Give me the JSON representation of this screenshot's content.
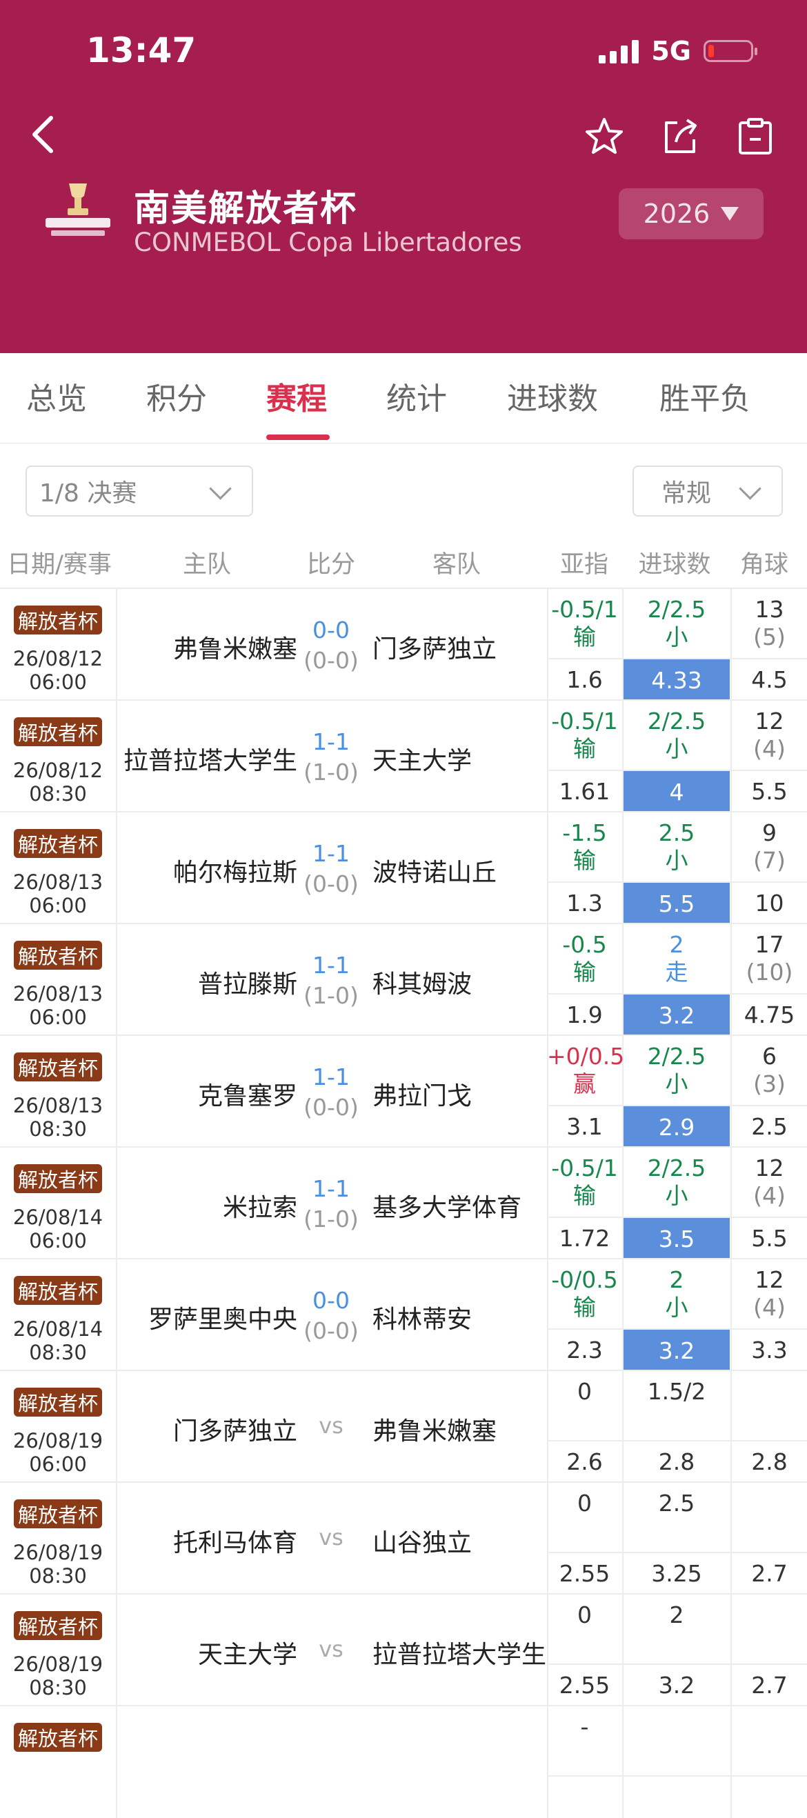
{
  "status": {
    "time": "13:47",
    "network": "5G"
  },
  "header": {
    "title_cn": "南美解放者杯",
    "title_en": "CONMEBOL Copa Libertadores",
    "year": "2026"
  },
  "tabs": [
    "总览",
    "积分",
    "赛程",
    "统计",
    "进球数",
    "胜平负"
  ],
  "filters": {
    "round": "1/8 决赛",
    "mode": "常规"
  },
  "columns": [
    "日期/赛事",
    "主队",
    "比分",
    "客队",
    "亚指",
    "进球数",
    "角球"
  ],
  "matches": [
    {
      "comp": "解放者杯",
      "date": "26/08/12",
      "time": "06:00",
      "home": "弗鲁米嫩塞",
      "away": "门多萨独立",
      "ft": "0-0",
      "ht": "(0-0)",
      "ah": "-0.5/1",
      "ah_res": "输",
      "ah_odds": "1.6",
      "goals": "2/2.5",
      "goals_res": "小",
      "goals_odds": "4.33",
      "corner": "13",
      "corner_ht": "(5)",
      "corner_odds": "4.5"
    },
    {
      "comp": "解放者杯",
      "date": "26/08/12",
      "time": "08:30",
      "home": "拉普拉塔大学生",
      "away": "天主大学",
      "ft": "1-1",
      "ht": "(1-0)",
      "ah": "-0.5/1",
      "ah_res": "输",
      "ah_odds": "1.61",
      "goals": "2/2.5",
      "goals_res": "小",
      "goals_odds": "4",
      "corner": "12",
      "corner_ht": "(4)",
      "corner_odds": "5.5"
    },
    {
      "comp": "解放者杯",
      "date": "26/08/13",
      "time": "06:00",
      "home": "帕尔梅拉斯",
      "away": "波特诺山丘",
      "ft": "1-1",
      "ht": "(0-0)",
      "ah": "-1.5",
      "ah_res": "输",
      "ah_odds": "1.3",
      "goals": "2.5",
      "goals_res": "小",
      "goals_odds": "5.5",
      "corner": "9",
      "corner_ht": "(7)",
      "corner_odds": "10"
    },
    {
      "comp": "解放者杯",
      "date": "26/08/13",
      "time": "06:00",
      "home": "普拉滕斯",
      "away": "科其姆波",
      "ft": "1-1",
      "ht": "(1-0)",
      "ah": "-0.5",
      "ah_res": "输",
      "ah_odds": "1.9",
      "goals": "2",
      "goals_res": "走",
      "goals_odds": "3.2",
      "corner": "17",
      "corner_ht": "(10)",
      "corner_odds": "4.75"
    },
    {
      "comp": "解放者杯",
      "date": "26/08/13",
      "time": "08:30",
      "home": "克鲁塞罗",
      "away": "弗拉门戈",
      "ft": "1-1",
      "ht": "(0-0)",
      "ah": "+0/0.5",
      "ah_res": "赢",
      "ah_odds": "3.1",
      "goals": "2/2.5",
      "goals_res": "小",
      "goals_odds": "2.9",
      "corner": "6",
      "corner_ht": "(3)",
      "corner_odds": "2.5"
    },
    {
      "comp": "解放者杯",
      "date": "26/08/14",
      "time": "06:00",
      "home": "米拉索",
      "away": "基多大学体育",
      "ft": "1-1",
      "ht": "(1-0)",
      "ah": "-0.5/1",
      "ah_res": "输",
      "ah_odds": "1.72",
      "goals": "2/2.5",
      "goals_res": "小",
      "goals_odds": "3.5",
      "corner": "12",
      "corner_ht": "(4)",
      "corner_odds": "5.5"
    },
    {
      "comp": "解放者杯",
      "date": "26/08/14",
      "time": "08:30",
      "home": "罗萨里奥中央",
      "away": "科林蒂安",
      "ft": "0-0",
      "ht": "(0-0)",
      "ah": "-0/0.5",
      "ah_res": "输",
      "ah_odds": "2.3",
      "goals": "2",
      "goals_res": "小",
      "goals_odds": "3.2",
      "corner": "12",
      "corner_ht": "(4)",
      "corner_odds": "3.3"
    },
    {
      "comp": "解放者杯",
      "date": "26/08/19",
      "time": "06:00",
      "home": "门多萨独立",
      "away": "弗鲁米嫩塞",
      "vs": "vs",
      "ah": "0",
      "ah_odds": "2.6",
      "goals": "1.5/2",
      "goals_odds": "2.8",
      "corner_odds": "2.8"
    },
    {
      "comp": "解放者杯",
      "date": "26/08/19",
      "time": "08:30",
      "home": "托利马体育",
      "away": "山谷独立",
      "vs": "vs",
      "ah": "0",
      "ah_odds": "2.55",
      "goals": "2.5",
      "goals_odds": "3.25",
      "corner_odds": "2.7"
    },
    {
      "comp": "解放者杯",
      "date": "26/08/19",
      "time": "08:30",
      "home": "天主大学",
      "away": "拉普拉塔大学生",
      "vs": "vs",
      "ah": "0",
      "ah_odds": "2.55",
      "goals": "2",
      "goals_odds": "3.2",
      "corner_odds": "2.7"
    },
    {
      "comp": "解放者杯",
      "ah": "-"
    }
  ]
}
